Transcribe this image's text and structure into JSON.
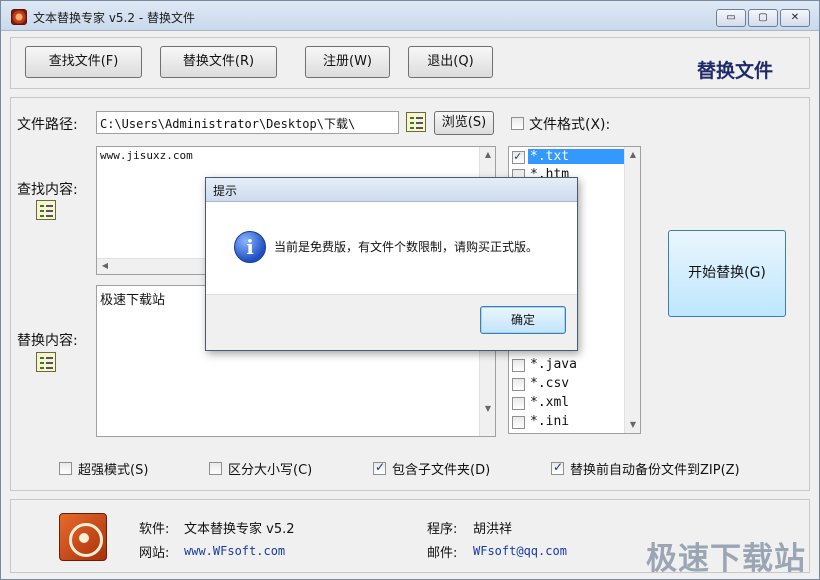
{
  "window": {
    "title": "文本替换专家 v5.2  -  替换文件",
    "controls": [
      "▭",
      "▢",
      "✕"
    ]
  },
  "toolbar": {
    "find_files": "查找文件(F)",
    "replace_files": "替换文件(R)",
    "register": "注册(W)",
    "exit": "退出(Q)",
    "heading": "替换文件"
  },
  "form": {
    "path_label": "文件路径:",
    "path_value": "C:\\Users\\Administrator\\Desktop\\下载\\",
    "browse": "浏览(S)",
    "find_label": "查找内容:",
    "find_value": "www.jisuxz.com",
    "replace_label": "替换内容:",
    "replace_value": "极速下载站",
    "format_label": "文件格式(X):",
    "start": "开始替换(G)"
  },
  "formats": [
    {
      "label": "*.txt",
      "checked": true,
      "selected": true
    },
    {
      "label": "*.htm",
      "checked": false,
      "selected": false
    },
    {
      "label": "*.java",
      "checked": false,
      "selected": false
    },
    {
      "label": "*.csv",
      "checked": false,
      "selected": false
    },
    {
      "label": "*.xml",
      "checked": false,
      "selected": false
    },
    {
      "label": "*.ini",
      "checked": false,
      "selected": false
    }
  ],
  "options": [
    {
      "label": "超强模式(S)",
      "checked": false
    },
    {
      "label": "区分大小写(C)",
      "checked": false
    },
    {
      "label": "包含子文件夹(D)",
      "checked": true
    },
    {
      "label": "替换前自动备份文件到ZIP(Z)",
      "checked": true
    }
  ],
  "footer": {
    "software_label": "软件:",
    "software_value": "文本替换专家 v5.2",
    "website_label": "网站:",
    "website_value": "www.WFsoft.com",
    "author_label": "程序:",
    "author_value": "胡洪祥",
    "email_label": "邮件:",
    "email_value": "WFsoft@qq.com"
  },
  "dialog": {
    "title": "提示",
    "message": "当前是免费版，有文件个数限制，请购买正式版。",
    "ok": "确定"
  },
  "watermark": "极速下载站"
}
